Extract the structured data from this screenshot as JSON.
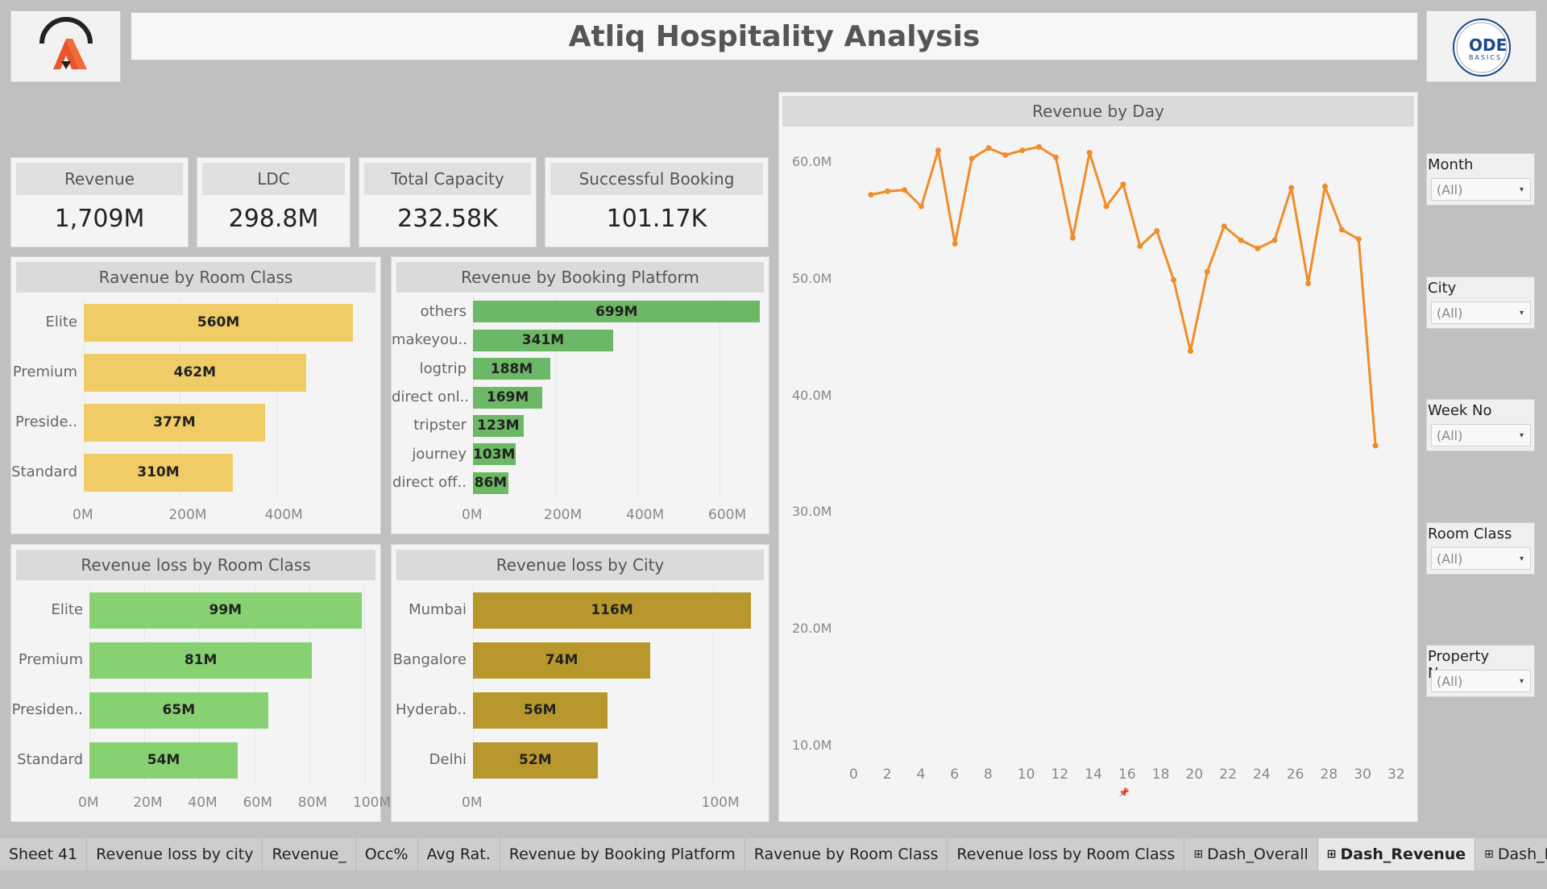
{
  "title": "Atliq Hospitality Analysis",
  "logos": {
    "left": "atliq-logo",
    "right_text": "ODE",
    "right_subtext": "BASICS"
  },
  "kpis": [
    {
      "label": "Revenue",
      "value": "1,709M"
    },
    {
      "label": "LDC",
      "value": "298.8M"
    },
    {
      "label": "Total Capacity",
      "value": "232.58K"
    },
    {
      "label": "Successful Booking",
      "value": "101.17K"
    }
  ],
  "colors": {
    "yellow": "#f0cc66",
    "green": "#6db866",
    "light_green": "#88d173",
    "olive": "#b8982c",
    "orange": "#f08c2a"
  },
  "chart_data": [
    {
      "type": "bar",
      "title": "Ravenue by Room Class",
      "categories": [
        "Elite",
        "Premium",
        "Preside..",
        "Standard"
      ],
      "values": [
        560,
        462,
        377,
        310
      ],
      "labels": [
        "560M",
        "462M",
        "377M",
        "310M"
      ],
      "xticks": [
        "0M",
        "200M",
        "400M"
      ],
      "xlim": [
        0,
        600
      ]
    },
    {
      "type": "bar",
      "title": "Revenue by Booking Platform",
      "categories": [
        "others",
        "makeyou..",
        "logtrip",
        "direct onl..",
        "tripster",
        "journey",
        "direct off.."
      ],
      "values": [
        699,
        341,
        188,
        169,
        123,
        103,
        86
      ],
      "labels": [
        "699M",
        "341M",
        "188M",
        "169M",
        "123M",
        "103M",
        "86M"
      ],
      "xticks": [
        "0M",
        "200M",
        "400M",
        "600M"
      ],
      "xlim": [
        0,
        700
      ]
    },
    {
      "type": "bar",
      "title": "Revenue loss by Room Class",
      "categories": [
        "Elite",
        "Premium",
        "Presiden..",
        "Standard"
      ],
      "values": [
        99,
        81,
        65,
        54
      ],
      "labels": [
        "99M",
        "81M",
        "65M",
        "54M"
      ],
      "xticks": [
        "0M",
        "20M",
        "40M",
        "60M",
        "80M",
        "100M"
      ],
      "xlim": [
        0,
        100
      ]
    },
    {
      "type": "bar",
      "title": "Revenue loss by City",
      "categories": [
        "Mumbai",
        "Bangalore",
        "Hyderab..",
        "Delhi"
      ],
      "values": [
        116,
        74,
        56,
        52
      ],
      "labels": [
        "116M",
        "74M",
        "56M",
        "52M"
      ],
      "xticks": [
        "0M",
        "100M"
      ],
      "xlim": [
        0,
        120
      ]
    },
    {
      "type": "line",
      "title": "Revenue by Day",
      "x": [
        1,
        2,
        3,
        4,
        5,
        6,
        7,
        8,
        9,
        10,
        11,
        12,
        13,
        14,
        15,
        16,
        17,
        18,
        19,
        20,
        21,
        22,
        23,
        24,
        25,
        26,
        27,
        28,
        29,
        30,
        31
      ],
      "values": [
        57.2,
        57.5,
        57.6,
        56.2,
        61.0,
        53.0,
        60.3,
        61.2,
        60.6,
        61.0,
        61.3,
        60.4,
        53.5,
        60.8,
        56.2,
        58.1,
        52.8,
        54.1,
        49.9,
        43.8,
        50.6,
        54.5,
        53.3,
        52.6,
        53.3,
        57.8,
        49.6,
        57.9,
        54.2,
        53.4,
        35.7
      ],
      "yticks": [
        "10.0M",
        "20.0M",
        "30.0M",
        "40.0M",
        "50.0M",
        "60.0M"
      ],
      "xticks": [
        "0",
        "2",
        "4",
        "6",
        "8",
        "10",
        "12",
        "14",
        "16",
        "18",
        "20",
        "22",
        "24",
        "26",
        "28",
        "30",
        "32"
      ],
      "ylim": [
        10,
        61.8
      ],
      "xlim": [
        0,
        32
      ]
    }
  ],
  "filters": [
    {
      "label": "Month",
      "value": "(All)"
    },
    {
      "label": "City",
      "value": "(All)"
    },
    {
      "label": "Week No",
      "value": "(All)"
    },
    {
      "label": "Room Class",
      "value": "(All)"
    },
    {
      "label": "Property Name",
      "value": "(All)"
    }
  ],
  "tabs": [
    "Sheet 41",
    "Revenue loss by city",
    "Revenue_",
    "Occ%",
    "Avg Rat.",
    "Revenue by Booking Platform",
    "Ravenue by Room Class",
    "Revenue loss by Room Class",
    "Dash_Overall",
    "Dash_Revenue",
    "Dash_KPI's"
  ],
  "active_tab": "Dash_Revenue"
}
